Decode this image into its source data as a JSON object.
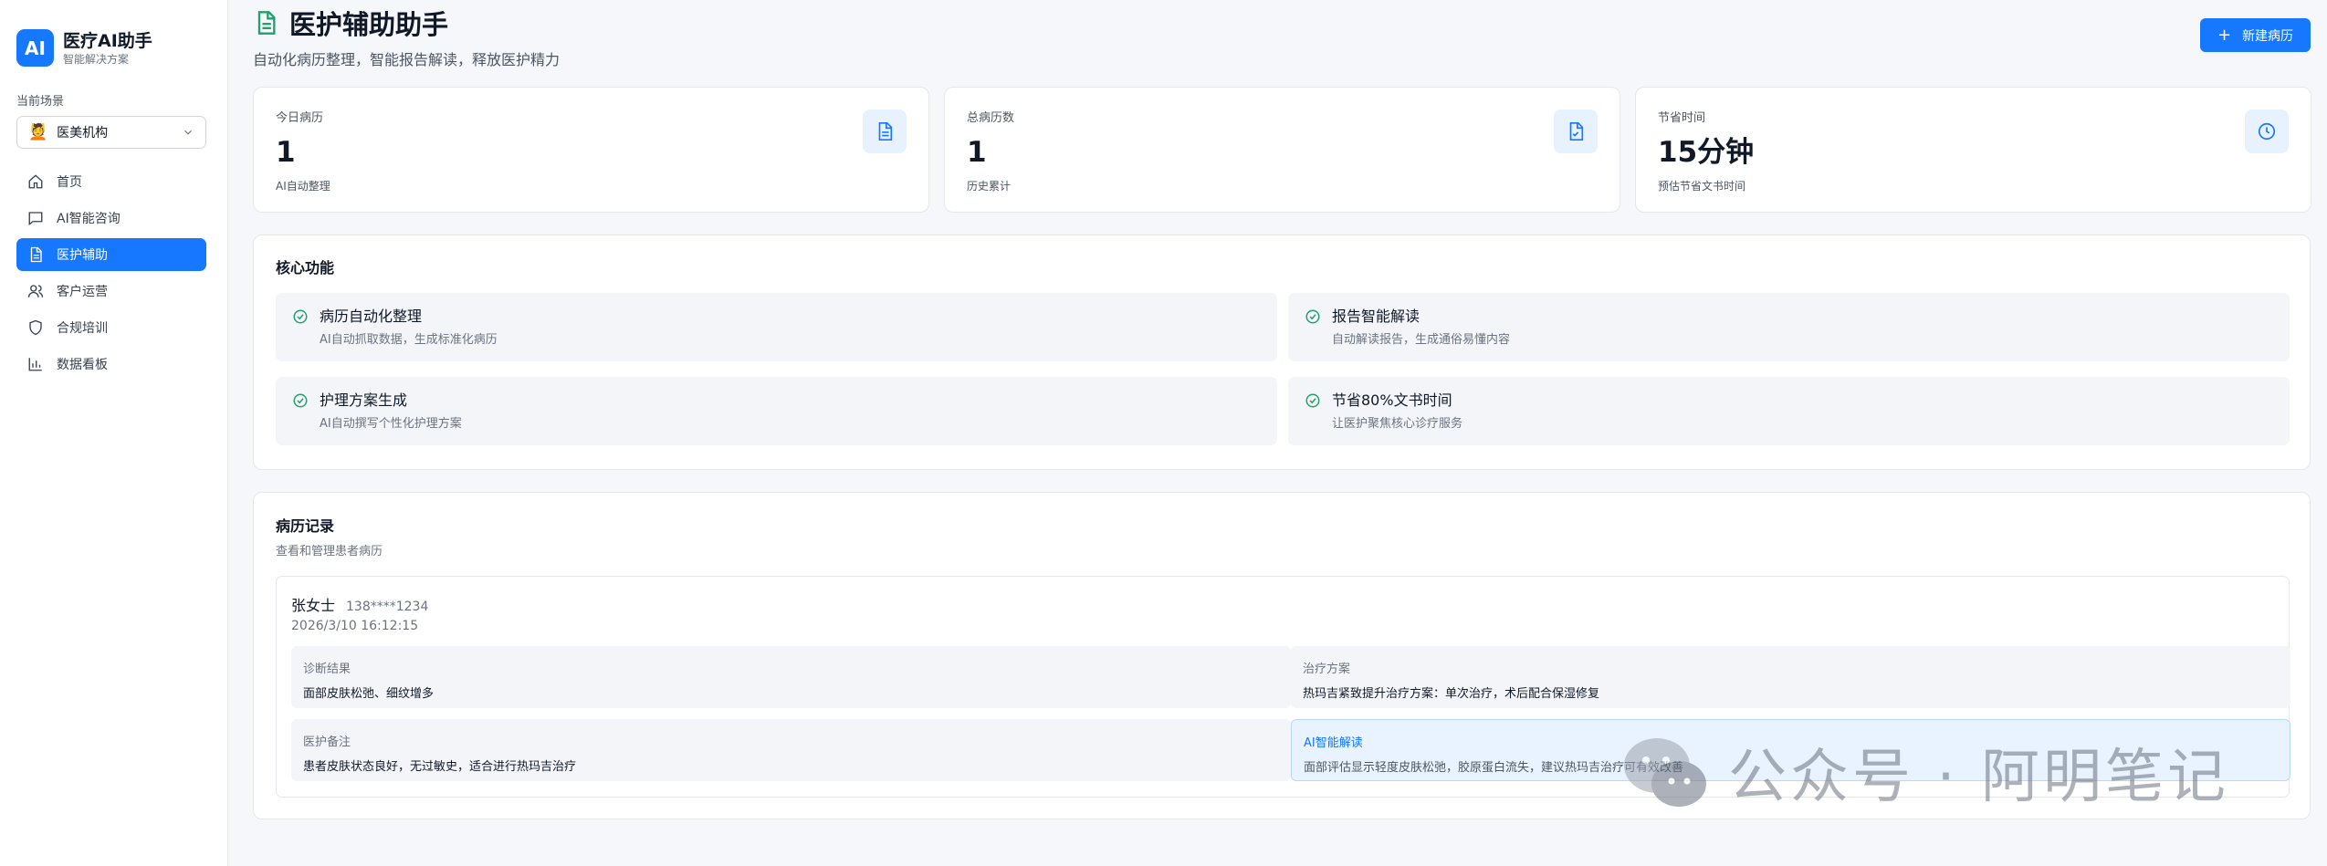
{
  "brand": {
    "logo_text": "AI",
    "title": "医疗AI助手",
    "subtitle": "智能解决方案"
  },
  "scene": {
    "label": "当前场景",
    "selected": "医美机构",
    "emoji": "💆"
  },
  "nav": [
    {
      "label": "首页",
      "icon": "home-icon",
      "active": false
    },
    {
      "label": "AI智能咨询",
      "icon": "chat-icon",
      "active": false
    },
    {
      "label": "医护辅助",
      "icon": "document-icon",
      "active": true
    },
    {
      "label": "客户运营",
      "icon": "users-icon",
      "active": false
    },
    {
      "label": "合规培训",
      "icon": "shield-icon",
      "active": false
    },
    {
      "label": "数据看板",
      "icon": "bar-chart-icon",
      "active": false
    }
  ],
  "header": {
    "title": "医护辅助助手",
    "subtitle": "自动化病历整理，智能报告解读，释放医护精力",
    "new_button": "新建病历"
  },
  "stats": [
    {
      "label": "今日病历",
      "value": "1",
      "note": "AI自动整理",
      "icon": "document-icon"
    },
    {
      "label": "总病历数",
      "value": "1",
      "note": "历史累计",
      "icon": "file-check-icon"
    },
    {
      "label": "节省时间",
      "value": "15分钟",
      "note": "预估节省文书时间",
      "icon": "clock-icon"
    }
  ],
  "features": {
    "title": "核心功能",
    "items": [
      {
        "title": "病历自动化整理",
        "desc": "AI自动抓取数据，生成标准化病历"
      },
      {
        "title": "报告智能解读",
        "desc": "自动解读报告，生成通俗易懂内容"
      },
      {
        "title": "护理方案生成",
        "desc": "AI自动撰写个性化护理方案"
      },
      {
        "title": "节省80%文书时间",
        "desc": "让医护聚焦核心诊疗服务"
      }
    ]
  },
  "records": {
    "title": "病历记录",
    "subtitle": "查看和管理患者病历",
    "items": [
      {
        "name": "张女士",
        "phone": "138****1234",
        "time": "2026/3/10 16:12:15",
        "fields": {
          "diagnosis": {
            "label": "诊断结果",
            "value": "面部皮肤松弛、细纹增多"
          },
          "treatment": {
            "label": "治疗方案",
            "value": "热玛吉紧致提升治疗方案：单次治疗，术后配合保湿修复"
          },
          "notes": {
            "label": "医护备注",
            "value": "患者皮肤状态良好，无过敏史，适合进行热玛吉治疗"
          },
          "ai": {
            "label": "AI智能解读",
            "value": "面部评估显示轻度皮肤松弛，胶原蛋白流失，建议热玛吉治疗可有效改善"
          }
        }
      }
    ]
  },
  "watermark": {
    "text": "公众号 · 阿明笔记"
  },
  "colors": {
    "accent": "#1677ff",
    "success": "#22a06b"
  }
}
